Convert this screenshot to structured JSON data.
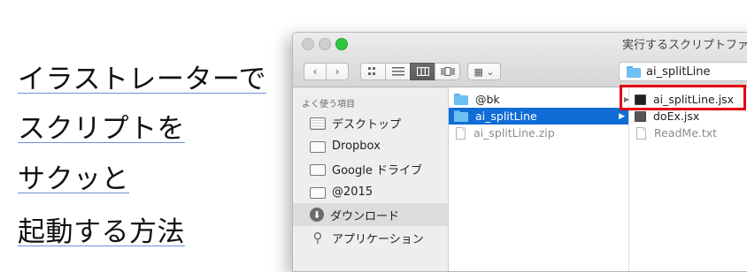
{
  "headline": {
    "line1": "イラストレーターで",
    "line2": "スクリプトを",
    "line3": "サクッと",
    "line4": "起動する方法"
  },
  "window": {
    "title": "実行するスクリプトファ",
    "path_label": "ai_splitLine",
    "nav_back": "‹",
    "nav_forward": "›",
    "arrange_glyph": "▦ ⌄"
  },
  "sidebar": {
    "heading": "よく使う項目",
    "items": [
      {
        "label": "デスクトップ",
        "icon": "desktop-icon"
      },
      {
        "label": "Dropbox",
        "icon": "folder-icon"
      },
      {
        "label": "Google ドライブ",
        "icon": "folder-icon"
      },
      {
        "label": "@2015",
        "icon": "folder-icon"
      },
      {
        "label": "ダウンロード",
        "icon": "download-icon",
        "selected": true
      },
      {
        "label": "アプリケーション",
        "icon": "applications-icon"
      }
    ]
  },
  "column1": {
    "items": [
      {
        "label": "@bk",
        "kind": "folder"
      },
      {
        "label": "ai_splitLine",
        "kind": "folder",
        "selected": true
      },
      {
        "label": "ai_splitLine.zip",
        "kind": "zip"
      }
    ]
  },
  "column2": {
    "items": [
      {
        "label": "ai_splitLine.jsx",
        "kind": "script",
        "highlighted": true
      },
      {
        "label": "doEx.jsx",
        "kind": "script"
      },
      {
        "label": "ReadMe.txt",
        "kind": "text"
      }
    ]
  },
  "colors": {
    "selection": "#116cd6",
    "highlight_box": "#e3000f",
    "underline": "#6c8fd8"
  }
}
